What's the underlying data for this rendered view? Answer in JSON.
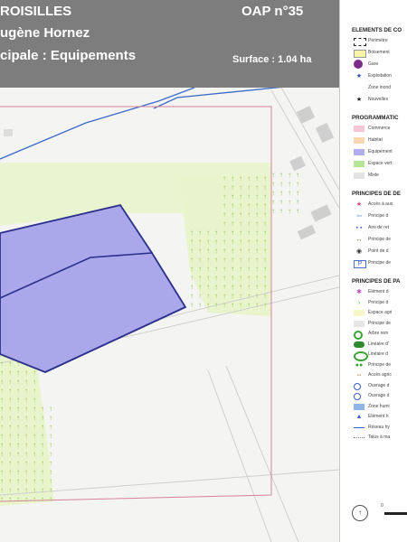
{
  "header": {
    "line1": "ROISILLES",
    "line2": "ugène Hornez",
    "line3": "cipale : Equipements",
    "oap": "OAP n°35",
    "surface": "Surface : 1.04 ha"
  },
  "colors": {
    "header_bg": "#7d7d7d",
    "perimeter": "#d7829a",
    "equipment": "#aaa7ea",
    "equipment_outline": "#2c2f8c",
    "nature": "#e8f5cc",
    "blue_line": "#3b6ac8",
    "tree": "#8fc73e",
    "buildings": "#cfcfcf"
  },
  "legend": {
    "sections": [
      {
        "title": "ELEMENTS DE CO",
        "items": [
          {
            "icon": "dashed-rect-icon",
            "label": "Périmètre"
          },
          {
            "icon": "yellow-square-icon",
            "label": "Boisement"
          },
          {
            "icon": "station-circle-icon",
            "label": "Gare"
          },
          {
            "icon": "star-icon",
            "label": "Exploitation"
          },
          {
            "icon": "dotted-zone-icon",
            "label": "Zone inond"
          },
          {
            "icon": "small-star-icon",
            "label": "Nouvelles"
          }
        ]
      },
      {
        "title": "PROGRAMMATIC",
        "items": [
          {
            "icon": "pink-square-icon",
            "label": "Commerce"
          },
          {
            "icon": "orange-square-icon",
            "label": "Habitat"
          },
          {
            "icon": "violet-square-icon",
            "label": "Equipement"
          },
          {
            "icon": "green-square-icon",
            "label": "Espace vert"
          },
          {
            "icon": "grey-square-icon",
            "label": "Mixte"
          }
        ]
      },
      {
        "title": "PRINCIPES DE DE",
        "items": [
          {
            "icon": "red-star-icon",
            "label": "Accès à aux"
          },
          {
            "icon": "blue-arrow-icon",
            "label": "Principe d"
          },
          {
            "icon": "blue-dashes-icon",
            "label": "Aire de ret"
          },
          {
            "icon": "double-arrow-icon",
            "label": "Principe de"
          },
          {
            "icon": "point-icon",
            "label": "Point de d"
          },
          {
            "icon": "parking-icon",
            "label": "Principe de"
          }
        ]
      },
      {
        "title": "PRINCIPES DE PA",
        "items": [
          {
            "icon": "pink-asterisk-icon",
            "label": "Elément d"
          },
          {
            "icon": "green-chevron-icon",
            "label": "Principe d"
          },
          {
            "icon": "light-yellow-icon",
            "label": "Espace agri"
          },
          {
            "icon": "light-grey-icon",
            "label": "Principe de"
          },
          {
            "icon": "green-ring-icon",
            "label": "Arbre rem"
          },
          {
            "icon": "green-dots-icon",
            "label": "Linéaire d'"
          },
          {
            "icon": "green-double-ring-icon",
            "label": "Linéaire d"
          },
          {
            "icon": "green-small-dots-icon",
            "label": "Principe de"
          },
          {
            "icon": "brown-arrow-icon",
            "label": "Accès agric"
          },
          {
            "icon": "blue-ring-icon",
            "label": "Ouvrage d"
          },
          {
            "icon": "blue-ring-icon",
            "label": "Ouvrage d"
          },
          {
            "icon": "blue-rect-icon",
            "label": "Zone humi"
          },
          {
            "icon": "blue-triangle-icon",
            "label": "Elément h"
          },
          {
            "icon": "blue-line-icon",
            "label": "Réseau hy"
          },
          {
            "icon": "dotted-line-icon",
            "label": "Talus à ma"
          }
        ]
      }
    ]
  },
  "scale": {
    "compass": "compass-icon",
    "tick": "0"
  }
}
